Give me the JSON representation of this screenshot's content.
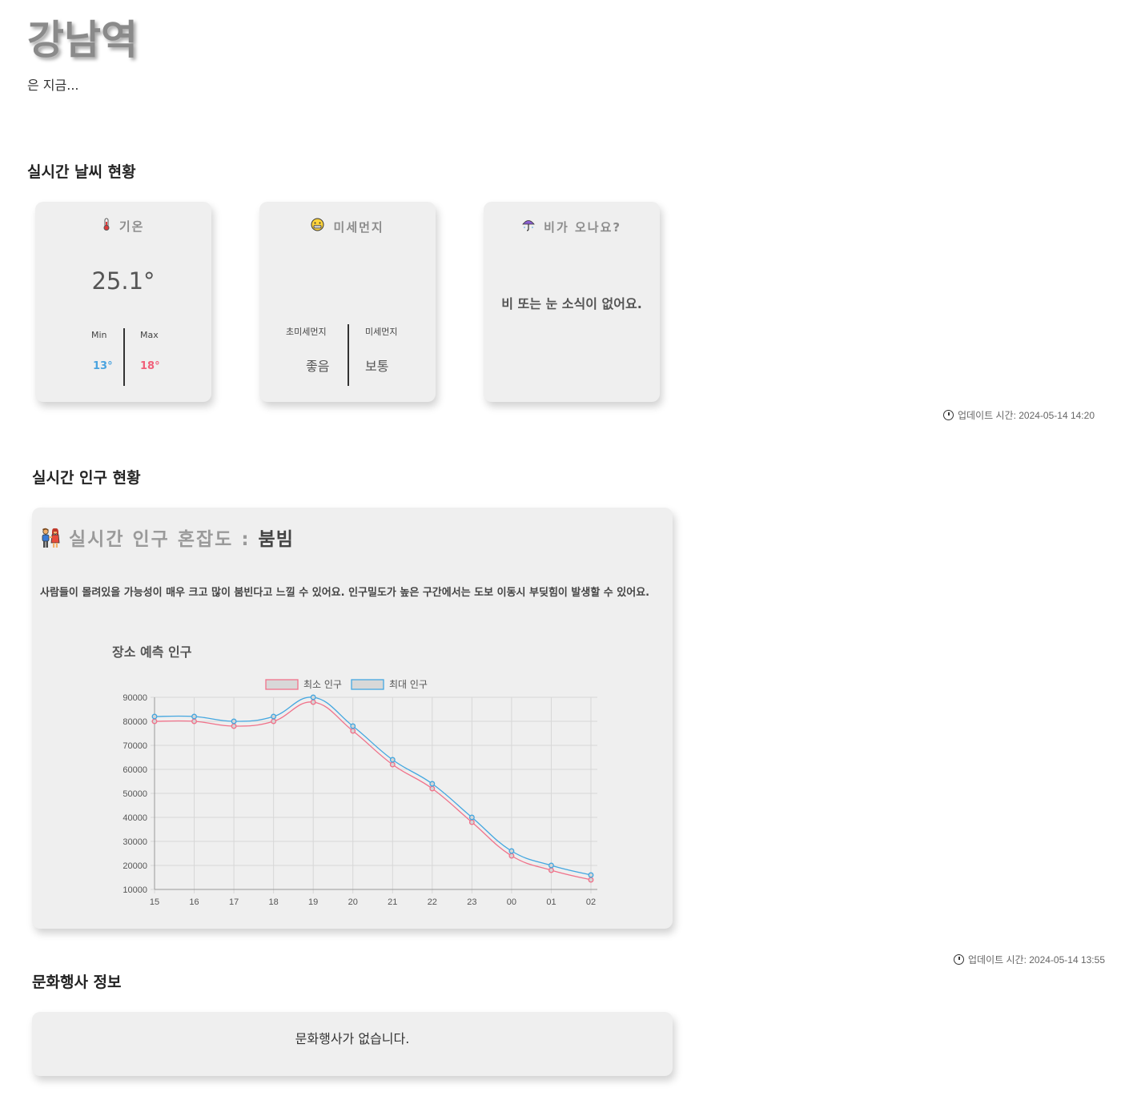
{
  "place": {
    "name": "강남역",
    "subtitle": "은 지금..."
  },
  "weather": {
    "section_title": "실시간 날씨 현황",
    "temperature": {
      "icon": "thermometer-icon",
      "title": "기온",
      "current": "25.1°",
      "min_label": "Min",
      "max_label": "Max",
      "min": "13°",
      "max": "18°",
      "min_color": "#4aa3df",
      "max_color": "#f0607a"
    },
    "dust": {
      "icon": "grimace-face-icon",
      "title": "미세먼지",
      "pm25_label": "초미세먼지",
      "pm10_label": "미세먼지",
      "pm25_value": "좋음",
      "pm10_value": "보통"
    },
    "rain": {
      "icon": "umbrella-icon",
      "title": "비가 오나요?",
      "message": "비 또는 눈 소식이 없어요."
    },
    "updated": "업데이트 시간: 2024-05-14 14:20"
  },
  "population": {
    "section_title": "실시간 인구 현황",
    "icon": "people-holding-hands-icon",
    "congestion_label": "실시간 인구 혼잡도 :",
    "congestion_level": "붐빔",
    "description": "사람들이 몰려있을 가능성이 매우 크고 많이 붐빈다고 느낄 수 있어요. 인구밀도가 높은 구간에서는 도보 이동시 부딪힘이 발생할 수 있어요.",
    "updated": "업데이트 시간: 2024-05-14 13:55"
  },
  "chart_data": {
    "type": "line",
    "title": "장소 예측 인구",
    "categories": [
      "15",
      "16",
      "17",
      "18",
      "19",
      "20",
      "21",
      "22",
      "23",
      "00",
      "01",
      "02"
    ],
    "series": [
      {
        "name": "최소 인구",
        "color": "#f0728a",
        "values": [
          80000,
          80000,
          78000,
          80000,
          88000,
          76000,
          62000,
          52000,
          38000,
          24000,
          18000,
          14000
        ]
      },
      {
        "name": "최대 인구",
        "color": "#44a7e0",
        "values": [
          82000,
          82000,
          80000,
          82000,
          90000,
          78000,
          64000,
          54000,
          40000,
          26000,
          20000,
          16000
        ]
      }
    ],
    "ylim": [
      10000,
      90000
    ],
    "yticks": [
      "90000",
      "80000",
      "70000",
      "60000",
      "50000",
      "40000",
      "30000",
      "20000",
      "10000"
    ],
    "grid": true,
    "legend": "top-center"
  },
  "events": {
    "section_title": "문화행사 정보",
    "message": "문화행사가 없습니다."
  }
}
